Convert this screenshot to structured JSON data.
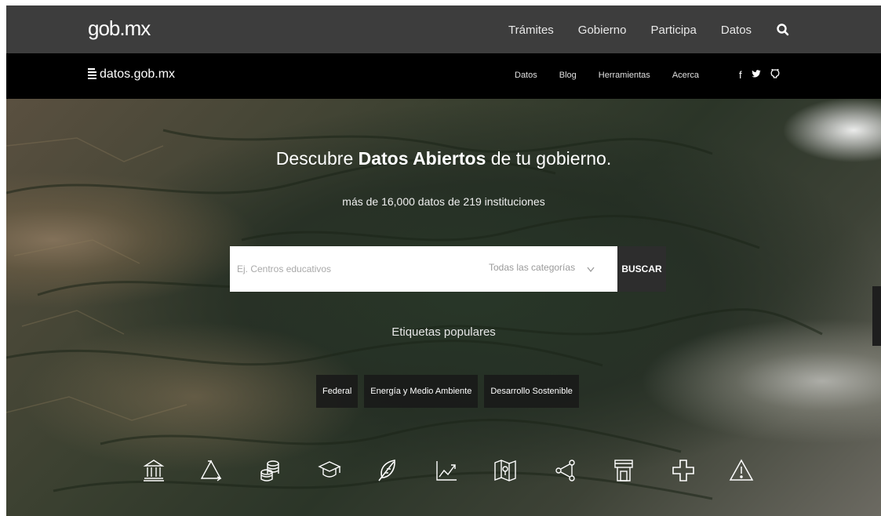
{
  "gov_bar": {
    "logo": "gob.mx",
    "nav": [
      "Trámites",
      "Gobierno",
      "Participa",
      "Datos"
    ],
    "search_icon": "search-icon"
  },
  "site_bar": {
    "logo": "datos.gob.mx",
    "logo_icon": "document-lines-icon",
    "nav": [
      "Datos",
      "Blog",
      "Herramientas",
      "Acerca"
    ],
    "social": {
      "facebook": "f",
      "twitter": "twitter-icon",
      "github": "github-icon"
    }
  },
  "hero": {
    "title_pre": "Descubre ",
    "title_bold": "Datos Abiertos",
    "title_post": " de tu gobierno.",
    "subtitle": "más de 16,000 datos de 219 instituciones",
    "search": {
      "placeholder": "Ej. Centros educativos",
      "category": "Todas las categorías",
      "button": "BUSCAR"
    },
    "tags_title": "Etiquetas populares",
    "tags": [
      "Federal",
      "Energía y Medio Ambiente",
      "Desarrollo Sostenible"
    ],
    "category_icons": [
      "government-building-icon",
      "recycle-triangle-icon",
      "coins-stack-icon",
      "graduation-cap-icon",
      "leaf-icon",
      "line-chart-icon",
      "map-pin-icon",
      "network-nodes-icon",
      "tower-icon",
      "health-cross-icon",
      "warning-triangle-icon"
    ]
  },
  "colors": {
    "gov_bar": "#3d3d3d",
    "site_bar": "#000000",
    "search_button": "#2d2d2d"
  }
}
